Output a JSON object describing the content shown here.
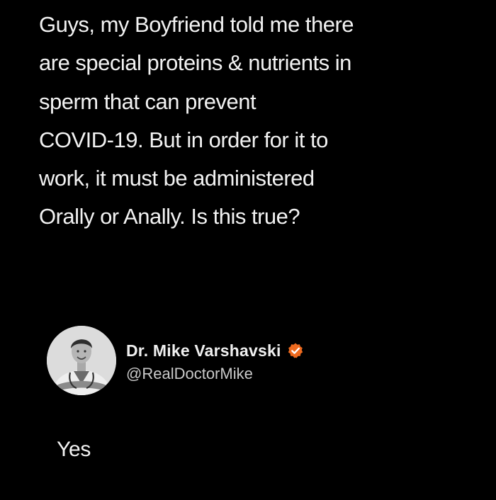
{
  "post": {
    "lines": [
      "Guys, my Boyfriend told me there",
      "are special proteins & nutrients in",
      "sperm that can prevent",
      "COVID-19. But in order for it to",
      "work, it must be administered",
      "Orally or Anally. Is this true?"
    ]
  },
  "reply": {
    "author_name": "Dr. Mike Varshavski",
    "author_handle": "@RealDoctorMike",
    "verified_icon": "verified-badge-icon",
    "badge_color": "#ee6a1f",
    "text": "Yes"
  },
  "theme": {
    "background": "#000000",
    "text": "#f2f2f2"
  }
}
